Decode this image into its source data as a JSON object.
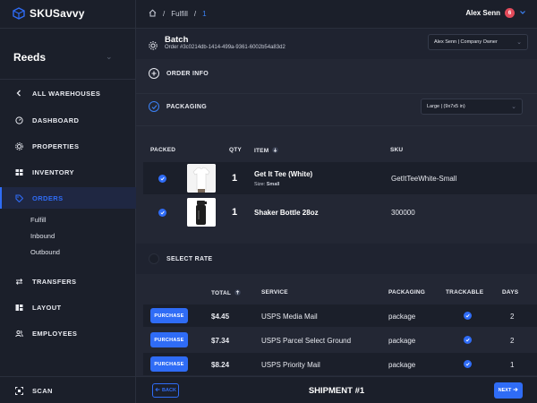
{
  "app": {
    "name": "SKUSavvy"
  },
  "sidebar": {
    "workspace": "Reeds",
    "back_label": "ALL WAREHOUSES",
    "items": [
      {
        "label": "DASHBOARD",
        "icon": "dashboard-icon"
      },
      {
        "label": "PROPERTIES",
        "icon": "gear-icon"
      },
      {
        "label": "INVENTORY",
        "icon": "grid-icon"
      },
      {
        "label": "ORDERS",
        "icon": "tag-icon",
        "active": true
      },
      {
        "label": "TRANSFERS",
        "icon": "arrows-icon"
      },
      {
        "label": "LAYOUT",
        "icon": "layout-icon"
      },
      {
        "label": "EMPLOYEES",
        "icon": "users-icon"
      }
    ],
    "orders_sub": [
      "Fulfill",
      "Inbound",
      "Outbound"
    ],
    "scan_label": "SCAN"
  },
  "header": {
    "breadcrumb": [
      "Fulfill",
      "1"
    ],
    "user_name": "Alex Senn",
    "notification_count": "6"
  },
  "batch": {
    "title": "Batch",
    "order_id": "Order #3c0214db-1414-499a-9361-6002b54a83d2",
    "assignee": "Alex Senn | Company Owner"
  },
  "sections": {
    "order_info": "ORDER INFO",
    "packaging": "PACKAGING",
    "packaging_value": "Large | (9x7x5 in)",
    "select_rate": "SELECT RATE"
  },
  "items_table": {
    "headers": {
      "packed": "PACKED",
      "qty": "QTY",
      "item": "ITEM",
      "sku": "SKU"
    },
    "rows": [
      {
        "qty": "1",
        "name": "Get It Tee (White)",
        "size_label": "Size:",
        "size": "Small",
        "sku": "GetItTeeWhite-Small",
        "image": "white-tshirt-image"
      },
      {
        "qty": "1",
        "name": "Shaker Bottle 28oz",
        "sku": "300000",
        "image": "shaker-bottle-image"
      }
    ]
  },
  "rates_table": {
    "headers": {
      "total": "TOTAL",
      "service": "SERVICE",
      "packaging": "PACKAGING",
      "trackable": "TRACKABLE",
      "days": "DAYS"
    },
    "purchase_label": "PURCHASE",
    "rows": [
      {
        "total": "$4.45",
        "service": "USPS Media Mail",
        "packaging": "package",
        "days": "2"
      },
      {
        "total": "$7.34",
        "service": "USPS Parcel Select Ground",
        "packaging": "package",
        "days": "2"
      },
      {
        "total": "$8.24",
        "service": "USPS Priority Mail",
        "packaging": "package",
        "days": "1"
      }
    ]
  },
  "footer": {
    "back_label": "BACK",
    "title": "SHIPMENT #1",
    "next_label": "NEXT"
  },
  "colors": {
    "accent": "#2f6cf6",
    "badge": "#e24a5a",
    "background": "#1b1f2a"
  }
}
